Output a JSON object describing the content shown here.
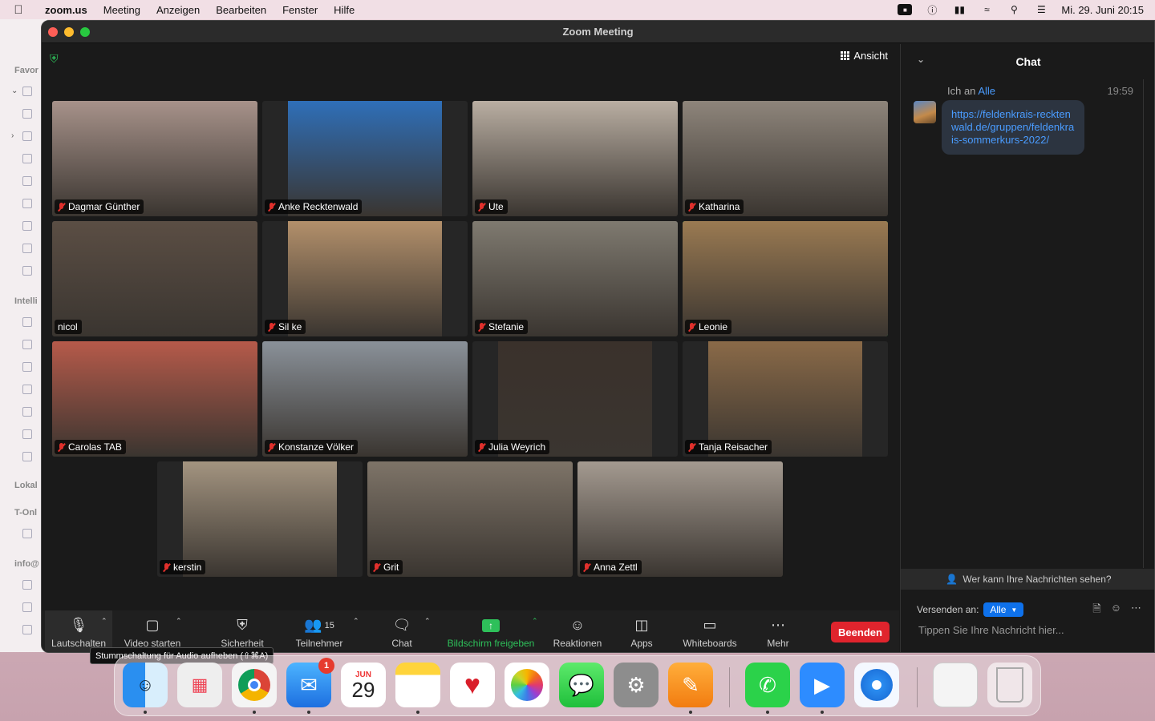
{
  "menubar": {
    "app": "zoom.us",
    "items": [
      "Meeting",
      "Anzeigen",
      "Bearbeiten",
      "Fenster",
      "Hilfe"
    ],
    "clock": "Mi. 29. Juni  20:15"
  },
  "bgapp": {
    "labels": [
      "Favor",
      "Intelli",
      "Lokal",
      "T-Onl",
      "info@"
    ]
  },
  "window": {
    "title": "Zoom Meeting",
    "view_label": "Ansicht"
  },
  "participants": [
    {
      "name": "Dagmar Günther",
      "muted": true,
      "active": false,
      "bg": "#a7928a"
    },
    {
      "name": "Anke Recktenwald",
      "muted": true,
      "active": false,
      "bg": "#2f6fb8"
    },
    {
      "name": "Ute",
      "muted": true,
      "active": false,
      "bg": "#b9aea2"
    },
    {
      "name": "Katharina",
      "muted": true,
      "active": false,
      "bg": "#8e857b"
    },
    {
      "name": "nicol",
      "muted": false,
      "active": false,
      "bg": "#5b4e44"
    },
    {
      "name": "Sil ke",
      "muted": true,
      "active": false,
      "bg": "#b3906b"
    },
    {
      "name": "Stefanie",
      "muted": true,
      "active": false,
      "bg": "#7f7a70"
    },
    {
      "name": "Leonie",
      "muted": true,
      "active": true,
      "bg": "#9a7a52"
    },
    {
      "name": "Carolas TAB",
      "muted": true,
      "active": false,
      "bg": "#b65a4a"
    },
    {
      "name": "Konstanze Völker",
      "muted": true,
      "active": false,
      "bg": "#8a9199"
    },
    {
      "name": "Julia Weyrich",
      "muted": true,
      "active": false,
      "bg": "#3a312b"
    },
    {
      "name": "Tanja Reisacher",
      "muted": true,
      "active": false,
      "bg": "#8a6a48"
    },
    {
      "name": "kerstin",
      "muted": true,
      "active": false,
      "bg": "#a39480"
    },
    {
      "name": "Grit",
      "muted": true,
      "active": false,
      "bg": "#7e7468"
    },
    {
      "name": "Anna Zettl",
      "muted": true,
      "active": false,
      "bg": "#a49a90"
    }
  ],
  "toolbar": {
    "mute": "Lautschalten",
    "video": "Video starten",
    "security": "Sicherheit",
    "participants": "Teilnehmer",
    "participants_count": "15",
    "chat": "Chat",
    "share": "Bildschirm freigeben",
    "reactions": "Reaktionen",
    "apps": "Apps",
    "whiteboards": "Whiteboards",
    "more": "Mehr",
    "end": "Beenden",
    "tooltip": "Stummschaltung für Audio aufheben (⇧⌘A)"
  },
  "chat": {
    "title": "Chat",
    "sender": "Ich an",
    "recipient": "Alle",
    "time": "19:59",
    "message": "https://feldenkrais-recktenwald.de/gruppen/feldenkrais-sommerkurs-2022/",
    "who_can_see": "Wer kann Ihre Nachrichten sehen?",
    "send_to_label": "Versenden an:",
    "send_to_value": "Alle",
    "input_placeholder": "Tippen Sie Ihre Nachricht hier..."
  },
  "dock": {
    "mail_badge": "1",
    "calendar_month": "JUN",
    "calendar_day": "29",
    "apps": [
      "finder",
      "launchpad",
      "chrome",
      "mail",
      "calendar",
      "notes",
      "health",
      "photos",
      "messages",
      "system-settings",
      "pages",
      "whatsapp",
      "zoom",
      "safari",
      "preview",
      "trash"
    ]
  }
}
